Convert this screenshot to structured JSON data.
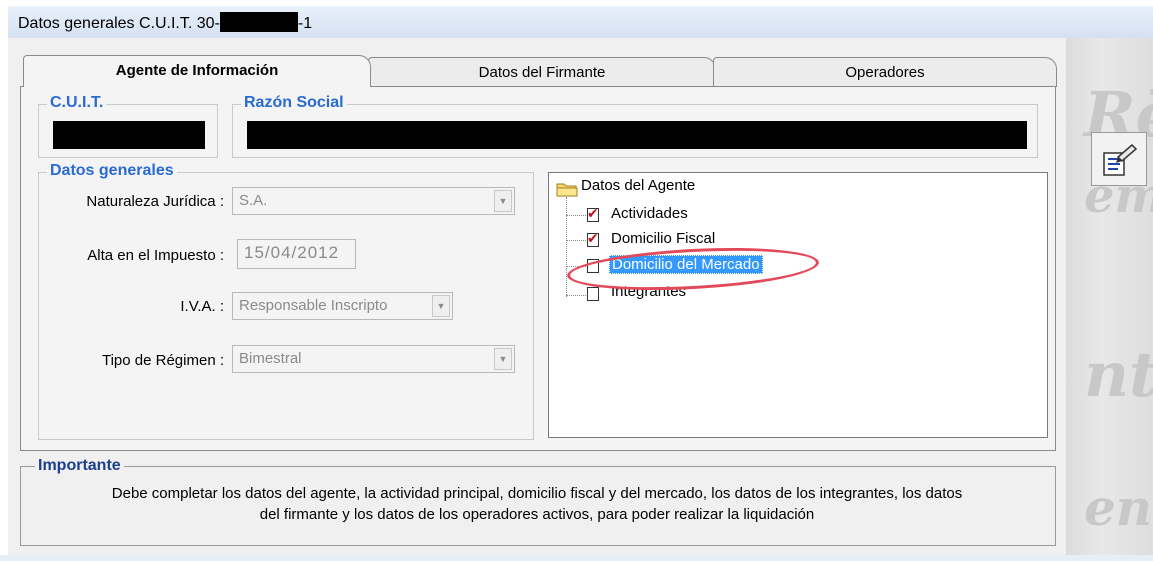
{
  "window": {
    "title_prefix": "Datos generales C.U.I.T. 30-",
    "title_suffix": "-1"
  },
  "tabs": [
    {
      "label": "Agente de Información",
      "active": true
    },
    {
      "label": "Datos del Firmante",
      "active": false
    },
    {
      "label": "Operadores",
      "active": false
    }
  ],
  "cuit_group": {
    "legend": "C.U.I.T."
  },
  "razon_group": {
    "legend": "Razón Social"
  },
  "datos_generales": {
    "legend": "Datos generales",
    "naturaleza": {
      "label": "Naturaleza Jurídica :",
      "value": "S.A."
    },
    "alta": {
      "label": "Alta en el Impuesto :",
      "value": "15/04/2012"
    },
    "iva": {
      "label": "I.V.A. :",
      "value": "Responsable Inscripto"
    },
    "regimen": {
      "label": "Tipo de Régimen :",
      "value": "Bimestral"
    }
  },
  "tree": {
    "root": "Datos del Agente",
    "items": [
      {
        "label": "Actividades",
        "checked": true
      },
      {
        "label": "Domicilio Fiscal",
        "checked": true
      },
      {
        "label": "Domicilio del Mercado",
        "checked": false,
        "selected": true
      },
      {
        "label": "Integrantes",
        "checked": false
      }
    ]
  },
  "important": {
    "legend": "Importante",
    "line1": "Debe completar los datos del agente, la actividad principal, domicilio fiscal y del mercado, los datos de los integrantes, los datos",
    "line2": "del firmante y los datos de los operadores activos, para poder realizar la liquidación"
  },
  "icons": {
    "side_button": "edit-document-icon",
    "tree_root": "folder-icon"
  },
  "colors": {
    "legend_blue": "#2a6ad1",
    "selection": "#3399ff",
    "check_mark": "#c0101c",
    "annotation_circle": "#e24a5a"
  }
}
